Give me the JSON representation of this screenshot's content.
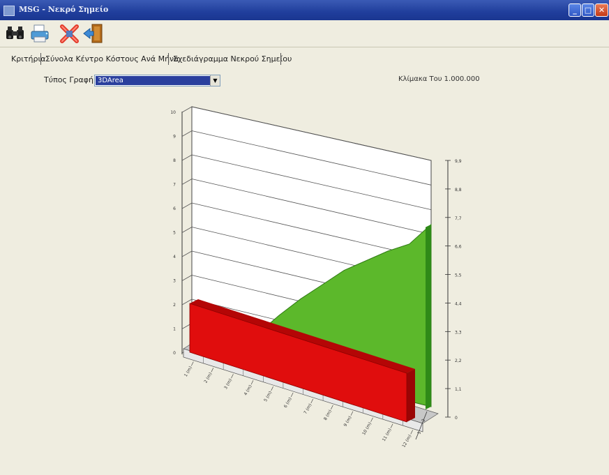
{
  "window": {
    "title": "MSG - Νεκρό Σημείο"
  },
  "titlebar_buttons": {
    "minimize": "_",
    "maximize": "□",
    "close": "✕"
  },
  "toolbar": {
    "find_icon": "binoculars-icon",
    "print_icon": "printer-icon",
    "delete_icon": "delete-x-icon",
    "exit_icon": "exit-door-icon"
  },
  "tabs": [
    {
      "label": "Κριτήρια"
    },
    {
      "label": "Σύνολα Κέντρο Κόστους Ανά Μήνα"
    },
    {
      "label": "Σχεδιάγραμμα Νεκρού Σημείου"
    }
  ],
  "controls": {
    "chart_type_label": "Τύπος Γραφήματος",
    "chart_type_value": "3DArea",
    "scale_note": "Κλίμακα Του 1.000.000"
  },
  "chart_data": {
    "type": "area",
    "render": "3d",
    "series": [
      {
        "color": "#e00d0d",
        "values": [
          2.6,
          2.6,
          2.6,
          2.6,
          2.6,
          2.6,
          2.6,
          2.6,
          2.6,
          2.6,
          2.6,
          2.6
        ]
      },
      {
        "color": "#5cb82b",
        "values": [
          0,
          0,
          0.3,
          1.2,
          2.2,
          3.1,
          3.9,
          4.7,
          5.3,
          5.9,
          6.4,
          7.4
        ]
      }
    ],
    "left_axis_ticks": [
      "10",
      "9",
      "8",
      "7",
      "6",
      "5",
      "4",
      "3",
      "2",
      "1",
      "0"
    ],
    "right_axis_ticks": [
      "9,9",
      "8,8",
      "7,7",
      "6,6",
      "5,5",
      "4,4",
      "3,3",
      "2,2",
      "1,1",
      "0"
    ],
    "x_tick_labels": [
      "1 (m)",
      "2 (m)",
      "3 (m)",
      "4 (m)",
      "5 (m)",
      "6 (m)",
      "7 (m)",
      "8 (m)",
      "9 (m)",
      "10 (m)",
      "11 (m)",
      "12 (m)"
    ],
    "depth_labels": [
      "1",
      "2"
    ],
    "grid": true
  }
}
